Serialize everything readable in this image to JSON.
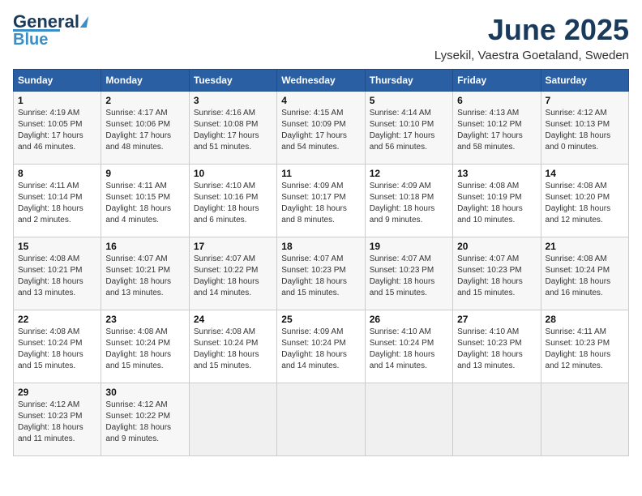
{
  "header": {
    "logo_line1": "General",
    "logo_line2": "Blue",
    "month": "June 2025",
    "location": "Lysekil, Vaestra Goetaland, Sweden"
  },
  "days_of_week": [
    "Sunday",
    "Monday",
    "Tuesday",
    "Wednesday",
    "Thursday",
    "Friday",
    "Saturday"
  ],
  "weeks": [
    [
      {
        "day": "1",
        "lines": [
          "Sunrise: 4:19 AM",
          "Sunset: 10:05 PM",
          "Daylight: 17 hours",
          "and 46 minutes."
        ]
      },
      {
        "day": "2",
        "lines": [
          "Sunrise: 4:17 AM",
          "Sunset: 10:06 PM",
          "Daylight: 17 hours",
          "and 48 minutes."
        ]
      },
      {
        "day": "3",
        "lines": [
          "Sunrise: 4:16 AM",
          "Sunset: 10:08 PM",
          "Daylight: 17 hours",
          "and 51 minutes."
        ]
      },
      {
        "day": "4",
        "lines": [
          "Sunrise: 4:15 AM",
          "Sunset: 10:09 PM",
          "Daylight: 17 hours",
          "and 54 minutes."
        ]
      },
      {
        "day": "5",
        "lines": [
          "Sunrise: 4:14 AM",
          "Sunset: 10:10 PM",
          "Daylight: 17 hours",
          "and 56 minutes."
        ]
      },
      {
        "day": "6",
        "lines": [
          "Sunrise: 4:13 AM",
          "Sunset: 10:12 PM",
          "Daylight: 17 hours",
          "and 58 minutes."
        ]
      },
      {
        "day": "7",
        "lines": [
          "Sunrise: 4:12 AM",
          "Sunset: 10:13 PM",
          "Daylight: 18 hours",
          "and 0 minutes."
        ]
      }
    ],
    [
      {
        "day": "8",
        "lines": [
          "Sunrise: 4:11 AM",
          "Sunset: 10:14 PM",
          "Daylight: 18 hours",
          "and 2 minutes."
        ]
      },
      {
        "day": "9",
        "lines": [
          "Sunrise: 4:11 AM",
          "Sunset: 10:15 PM",
          "Daylight: 18 hours",
          "and 4 minutes."
        ]
      },
      {
        "day": "10",
        "lines": [
          "Sunrise: 4:10 AM",
          "Sunset: 10:16 PM",
          "Daylight: 18 hours",
          "and 6 minutes."
        ]
      },
      {
        "day": "11",
        "lines": [
          "Sunrise: 4:09 AM",
          "Sunset: 10:17 PM",
          "Daylight: 18 hours",
          "and 8 minutes."
        ]
      },
      {
        "day": "12",
        "lines": [
          "Sunrise: 4:09 AM",
          "Sunset: 10:18 PM",
          "Daylight: 18 hours",
          "and 9 minutes."
        ]
      },
      {
        "day": "13",
        "lines": [
          "Sunrise: 4:08 AM",
          "Sunset: 10:19 PM",
          "Daylight: 18 hours",
          "and 10 minutes."
        ]
      },
      {
        "day": "14",
        "lines": [
          "Sunrise: 4:08 AM",
          "Sunset: 10:20 PM",
          "Daylight: 18 hours",
          "and 12 minutes."
        ]
      }
    ],
    [
      {
        "day": "15",
        "lines": [
          "Sunrise: 4:08 AM",
          "Sunset: 10:21 PM",
          "Daylight: 18 hours",
          "and 13 minutes."
        ]
      },
      {
        "day": "16",
        "lines": [
          "Sunrise: 4:07 AM",
          "Sunset: 10:21 PM",
          "Daylight: 18 hours",
          "and 13 minutes."
        ]
      },
      {
        "day": "17",
        "lines": [
          "Sunrise: 4:07 AM",
          "Sunset: 10:22 PM",
          "Daylight: 18 hours",
          "and 14 minutes."
        ]
      },
      {
        "day": "18",
        "lines": [
          "Sunrise: 4:07 AM",
          "Sunset: 10:23 PM",
          "Daylight: 18 hours",
          "and 15 minutes."
        ]
      },
      {
        "day": "19",
        "lines": [
          "Sunrise: 4:07 AM",
          "Sunset: 10:23 PM",
          "Daylight: 18 hours",
          "and 15 minutes."
        ]
      },
      {
        "day": "20",
        "lines": [
          "Sunrise: 4:07 AM",
          "Sunset: 10:23 PM",
          "Daylight: 18 hours",
          "and 15 minutes."
        ]
      },
      {
        "day": "21",
        "lines": [
          "Sunrise: 4:08 AM",
          "Sunset: 10:24 PM",
          "Daylight: 18 hours",
          "and 16 minutes."
        ]
      }
    ],
    [
      {
        "day": "22",
        "lines": [
          "Sunrise: 4:08 AM",
          "Sunset: 10:24 PM",
          "Daylight: 18 hours",
          "and 15 minutes."
        ]
      },
      {
        "day": "23",
        "lines": [
          "Sunrise: 4:08 AM",
          "Sunset: 10:24 PM",
          "Daylight: 18 hours",
          "and 15 minutes."
        ]
      },
      {
        "day": "24",
        "lines": [
          "Sunrise: 4:08 AM",
          "Sunset: 10:24 PM",
          "Daylight: 18 hours",
          "and 15 minutes."
        ]
      },
      {
        "day": "25",
        "lines": [
          "Sunrise: 4:09 AM",
          "Sunset: 10:24 PM",
          "Daylight: 18 hours",
          "and 14 minutes."
        ]
      },
      {
        "day": "26",
        "lines": [
          "Sunrise: 4:10 AM",
          "Sunset: 10:24 PM",
          "Daylight: 18 hours",
          "and 14 minutes."
        ]
      },
      {
        "day": "27",
        "lines": [
          "Sunrise: 4:10 AM",
          "Sunset: 10:23 PM",
          "Daylight: 18 hours",
          "and 13 minutes."
        ]
      },
      {
        "day": "28",
        "lines": [
          "Sunrise: 4:11 AM",
          "Sunset: 10:23 PM",
          "Daylight: 18 hours",
          "and 12 minutes."
        ]
      }
    ],
    [
      {
        "day": "29",
        "lines": [
          "Sunrise: 4:12 AM",
          "Sunset: 10:23 PM",
          "Daylight: 18 hours",
          "and 11 minutes."
        ]
      },
      {
        "day": "30",
        "lines": [
          "Sunrise: 4:12 AM",
          "Sunset: 10:22 PM",
          "Daylight: 18 hours",
          "and 9 minutes."
        ]
      },
      {
        "day": "",
        "lines": []
      },
      {
        "day": "",
        "lines": []
      },
      {
        "day": "",
        "lines": []
      },
      {
        "day": "",
        "lines": []
      },
      {
        "day": "",
        "lines": []
      }
    ]
  ]
}
